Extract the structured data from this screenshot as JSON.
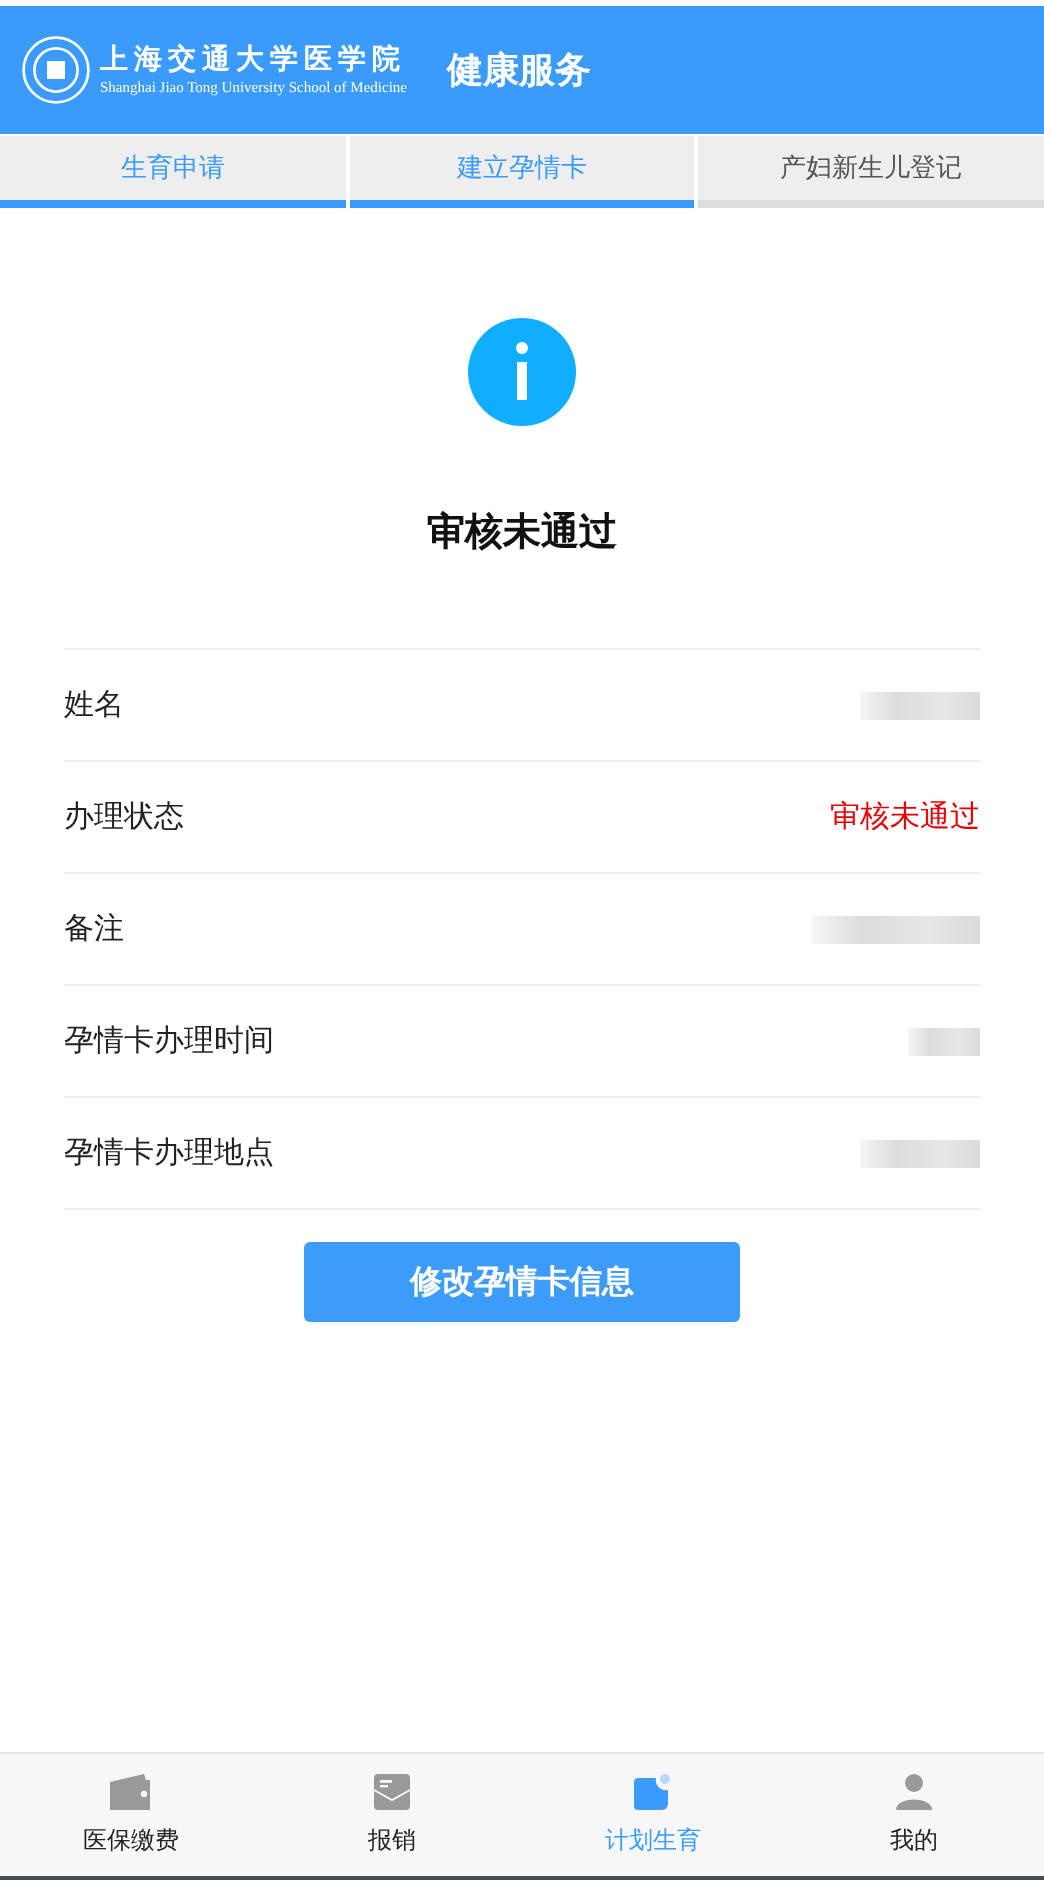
{
  "header": {
    "logo_cn": "上海交通大学医学院",
    "logo_en": "Shanghai Jiao Tong University School of Medicine",
    "title": "健康服务"
  },
  "tabs": [
    {
      "label": "生育申请",
      "selected": true
    },
    {
      "label": "建立孕情卡",
      "selected": true
    },
    {
      "label": "产妇新生儿登记",
      "selected": false
    }
  ],
  "result": {
    "title": "审核未通过"
  },
  "rows": [
    {
      "label": "姓名",
      "kind": "redacted"
    },
    {
      "label": "办理状态",
      "kind": "status",
      "value": "审核未通过"
    },
    {
      "label": "备注",
      "kind": "redacted"
    },
    {
      "label": "孕情卡办理时间",
      "kind": "redacted"
    },
    {
      "label": "孕情卡办理地点",
      "kind": "redacted"
    }
  ],
  "button": "修改孕情卡信息",
  "nav": [
    {
      "label": "医保缴费",
      "kind": "wallet",
      "selected": false
    },
    {
      "label": "报销",
      "kind": "mail",
      "selected": false
    },
    {
      "label": "计划生育",
      "kind": "plan",
      "selected": true
    },
    {
      "label": "我的",
      "kind": "person",
      "selected": false
    }
  ]
}
